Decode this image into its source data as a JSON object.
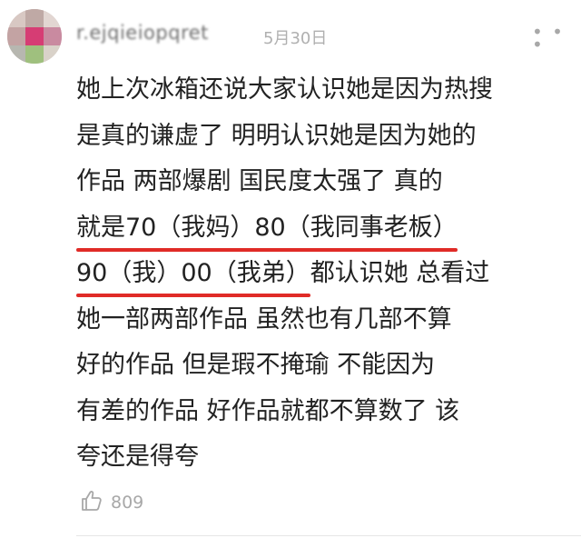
{
  "comment": {
    "username": "r.ejqieiopqret",
    "date": "5月30日",
    "more_icon": "more-dots-icon",
    "lines": [
      {
        "pre": "她上次冰箱还说大家认识她是因为热搜",
        "hl": "",
        "post": ""
      },
      {
        "pre": "是真的谦虚了   明明认识她是因为她的",
        "hl": "",
        "post": ""
      },
      {
        "pre": "作品    两部爆剧   国民度太强了    真的",
        "hl": "",
        "post": ""
      },
      {
        "pre": "",
        "hl": "就是70（我妈）80（我同事老板）",
        "post": ""
      },
      {
        "pre": "",
        "hl": "90（我）00（我弟）",
        "post": "都认识她  总看过"
      },
      {
        "pre": "她一部两部作品     虽然也有几部不算",
        "hl": "",
        "post": ""
      },
      {
        "pre": "好的作品    但是瑕不掩瑜      不能因为",
        "hl": "",
        "post": ""
      },
      {
        "pre": "有差的作品   好作品就都不算数了   该",
        "hl": "",
        "post": ""
      },
      {
        "pre": "夸还是得夸",
        "hl": "",
        "post": ""
      }
    ],
    "highlight_color": "#e02b27",
    "like_icon": "thumbs-up-icon",
    "like_count": "809"
  }
}
